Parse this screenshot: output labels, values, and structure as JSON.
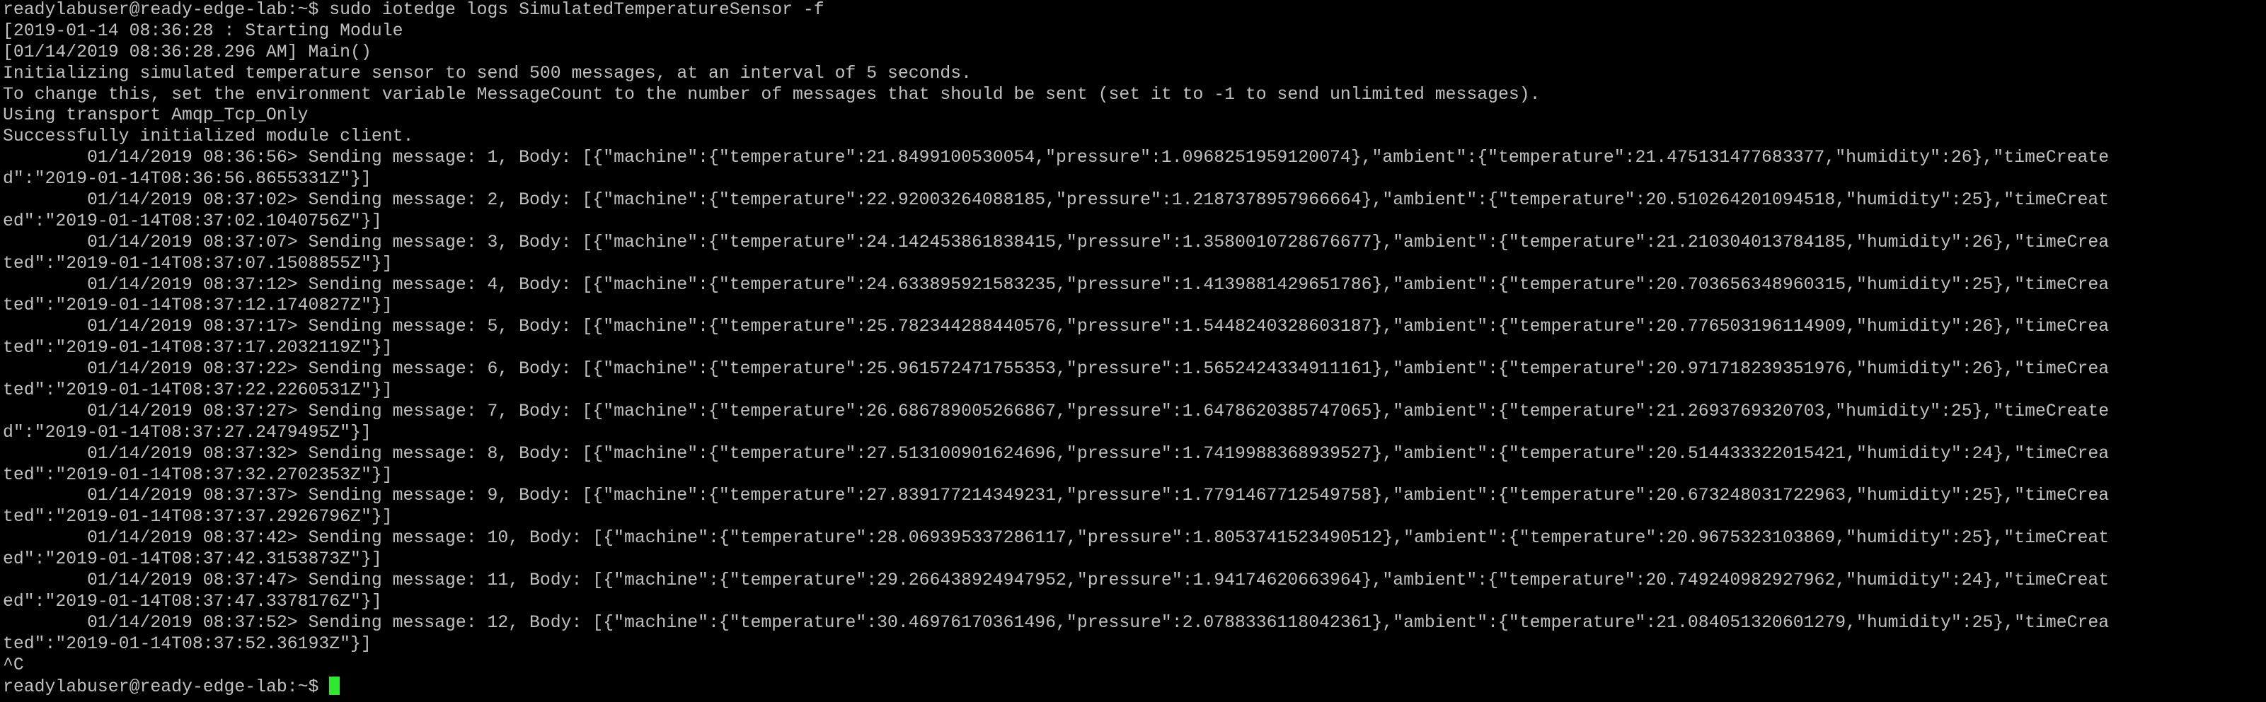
{
  "terminal": {
    "lines": [
      "readylabuser@ready-edge-lab:~$ sudo iotedge logs SimulatedTemperatureSensor -f",
      "[2019-01-14 08:36:28 : Starting Module",
      "[01/14/2019 08:36:28.296 AM] Main()",
      "Initializing simulated temperature sensor to send 500 messages, at an interval of 5 seconds.",
      "To change this, set the environment variable MessageCount to the number of messages that should be sent (set it to -1 to send unlimited messages).",
      "Using transport Amqp_Tcp_Only",
      "Successfully initialized module client.",
      "        01/14/2019 08:36:56> Sending message: 1, Body: [{\"machine\":{\"temperature\":21.8499100530054,\"pressure\":1.0968251959120074},\"ambient\":{\"temperature\":21.475131477683377,\"humidity\":26},\"timeCreate",
      "d\":\"2019-01-14T08:36:56.8655331Z\"}]",
      "        01/14/2019 08:37:02> Sending message: 2, Body: [{\"machine\":{\"temperature\":22.92003264088185,\"pressure\":1.2187378957966664},\"ambient\":{\"temperature\":20.510264201094518,\"humidity\":25},\"timeCreat",
      "ed\":\"2019-01-14T08:37:02.1040756Z\"}]",
      "        01/14/2019 08:37:07> Sending message: 3, Body: [{\"machine\":{\"temperature\":24.142453861838415,\"pressure\":1.3580010728676677},\"ambient\":{\"temperature\":21.210304013784185,\"humidity\":26},\"timeCrea",
      "ted\":\"2019-01-14T08:37:07.1508855Z\"}]",
      "        01/14/2019 08:37:12> Sending message: 4, Body: [{\"machine\":{\"temperature\":24.633895921583235,\"pressure\":1.4139881429651786},\"ambient\":{\"temperature\":20.703656348960315,\"humidity\":25},\"timeCrea",
      "ted\":\"2019-01-14T08:37:12.1740827Z\"}]",
      "        01/14/2019 08:37:17> Sending message: 5, Body: [{\"machine\":{\"temperature\":25.782344288440576,\"pressure\":1.5448240328603187},\"ambient\":{\"temperature\":20.776503196114909,\"humidity\":26},\"timeCrea",
      "ted\":\"2019-01-14T08:37:17.2032119Z\"}]",
      "        01/14/2019 08:37:22> Sending message: 6, Body: [{\"machine\":{\"temperature\":25.961572471755353,\"pressure\":1.5652424334911161},\"ambient\":{\"temperature\":20.971718239351976,\"humidity\":26},\"timeCrea",
      "ted\":\"2019-01-14T08:37:22.2260531Z\"}]",
      "        01/14/2019 08:37:27> Sending message: 7, Body: [{\"machine\":{\"temperature\":26.686789005266867,\"pressure\":1.6478620385747065},\"ambient\":{\"temperature\":21.2693769320703,\"humidity\":25},\"timeCreate",
      "d\":\"2019-01-14T08:37:27.2479495Z\"}]",
      "        01/14/2019 08:37:32> Sending message: 8, Body: [{\"machine\":{\"temperature\":27.513100901624696,\"pressure\":1.7419988368939527},\"ambient\":{\"temperature\":20.514433322015421,\"humidity\":24},\"timeCrea",
      "ted\":\"2019-01-14T08:37:32.2702353Z\"}]",
      "        01/14/2019 08:37:37> Sending message: 9, Body: [{\"machine\":{\"temperature\":27.839177214349231,\"pressure\":1.7791467712549758},\"ambient\":{\"temperature\":20.673248031722963,\"humidity\":25},\"timeCrea",
      "ted\":\"2019-01-14T08:37:37.2926796Z\"}]",
      "        01/14/2019 08:37:42> Sending message: 10, Body: [{\"machine\":{\"temperature\":28.069395337286117,\"pressure\":1.8053741523490512},\"ambient\":{\"temperature\":20.9675323103869,\"humidity\":25},\"timeCreat",
      "ed\":\"2019-01-14T08:37:42.3153873Z\"}]",
      "        01/14/2019 08:37:47> Sending message: 11, Body: [{\"machine\":{\"temperature\":29.266438924947952,\"pressure\":1.94174620663964},\"ambient\":{\"temperature\":20.749240982927962,\"humidity\":24},\"timeCreat",
      "ed\":\"2019-01-14T08:37:47.3378176Z\"}]",
      "        01/14/2019 08:37:52> Sending message: 12, Body: [{\"machine\":{\"temperature\":30.46976170361496,\"pressure\":2.0788336118042361},\"ambient\":{\"temperature\":21.084051320601279,\"humidity\":25},\"timeCrea",
      "ted\":\"2019-01-14T08:37:52.36193Z\"}]",
      "^C"
    ],
    "prompt": "readylabuser@ready-edge-lab:~$ ",
    "colors": {
      "background": "#000000",
      "foreground": "#c0c0c0",
      "cursor": "#2ee82e"
    }
  }
}
